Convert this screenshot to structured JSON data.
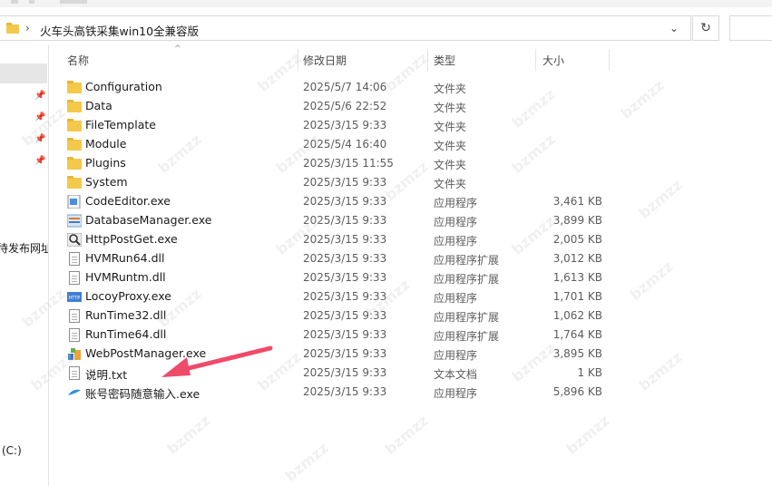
{
  "address": {
    "path": "火车头高铁采集win10全兼容版",
    "separator": "›",
    "chevron": "⌄",
    "refresh": "↻"
  },
  "nav": {
    "partial_item_1": "待发布网址",
    "partial_item_2": "(C:)"
  },
  "columns": {
    "name": "名称",
    "date": "修改日期",
    "type": "类型",
    "size": "大小"
  },
  "files": [
    {
      "name": "Configuration",
      "date": "2025/5/7 14:06",
      "type": "文件夹",
      "size": "",
      "icon": "folder-icon"
    },
    {
      "name": "Data",
      "date": "2025/5/6 22:52",
      "type": "文件夹",
      "size": "",
      "icon": "folder-icon"
    },
    {
      "name": "FileTemplate",
      "date": "2025/3/15 9:33",
      "type": "文件夹",
      "size": "",
      "icon": "folder-icon"
    },
    {
      "name": "Module",
      "date": "2025/5/4 16:40",
      "type": "文件夹",
      "size": "",
      "icon": "folder-icon"
    },
    {
      "name": "Plugins",
      "date": "2025/3/15 11:55",
      "type": "文件夹",
      "size": "",
      "icon": "folder-icon"
    },
    {
      "name": "System",
      "date": "2025/3/15 9:33",
      "type": "文件夹",
      "size": "",
      "icon": "folder-icon"
    },
    {
      "name": "CodeEditor.exe",
      "date": "2025/3/15 9:33",
      "type": "应用程序",
      "size": "3,461 KB",
      "icon": "code-editor-icon"
    },
    {
      "name": "DatabaseManager.exe",
      "date": "2025/3/15 9:33",
      "type": "应用程序",
      "size": "3,899 KB",
      "icon": "database-manager-icon"
    },
    {
      "name": "HttpPostGet.exe",
      "date": "2025/3/15 9:33",
      "type": "应用程序",
      "size": "2,005 KB",
      "icon": "magnifier-icon"
    },
    {
      "name": "HVMRun64.dll",
      "date": "2025/3/15 9:33",
      "type": "应用程序扩展",
      "size": "3,012 KB",
      "icon": "dll-file-icon"
    },
    {
      "name": "HVMRuntm.dll",
      "date": "2025/3/15 9:33",
      "type": "应用程序扩展",
      "size": "1,613 KB",
      "icon": "dll-file-icon"
    },
    {
      "name": "LocoyProxy.exe",
      "date": "2025/3/15 9:33",
      "type": "应用程序",
      "size": "1,701 KB",
      "icon": "http-proxy-icon"
    },
    {
      "name": "RunTime32.dll",
      "date": "2025/3/15 9:33",
      "type": "应用程序扩展",
      "size": "1,062 KB",
      "icon": "dll-file-icon"
    },
    {
      "name": "RunTime64.dll",
      "date": "2025/3/15 9:33",
      "type": "应用程序扩展",
      "size": "1,764 KB",
      "icon": "dll-file-icon"
    },
    {
      "name": "WebPostManager.exe",
      "date": "2025/3/15 9:33",
      "type": "应用程序",
      "size": "3,895 KB",
      "icon": "web-post-manager-icon"
    },
    {
      "name": "说明.txt",
      "date": "2025/3/15 9:33",
      "type": "文本文档",
      "size": "1 KB",
      "icon": "text-file-icon"
    },
    {
      "name": "账号密码随意输入.exe",
      "date": "2025/3/15 9:33",
      "type": "应用程序",
      "size": "5,896 KB",
      "icon": "blue-app-icon"
    }
  ],
  "watermark_text": "bzmzz",
  "colors": {
    "folder": "#f4c84a",
    "annotation_arrow": "#f04a6a",
    "selection": "#e6e6e6"
  }
}
